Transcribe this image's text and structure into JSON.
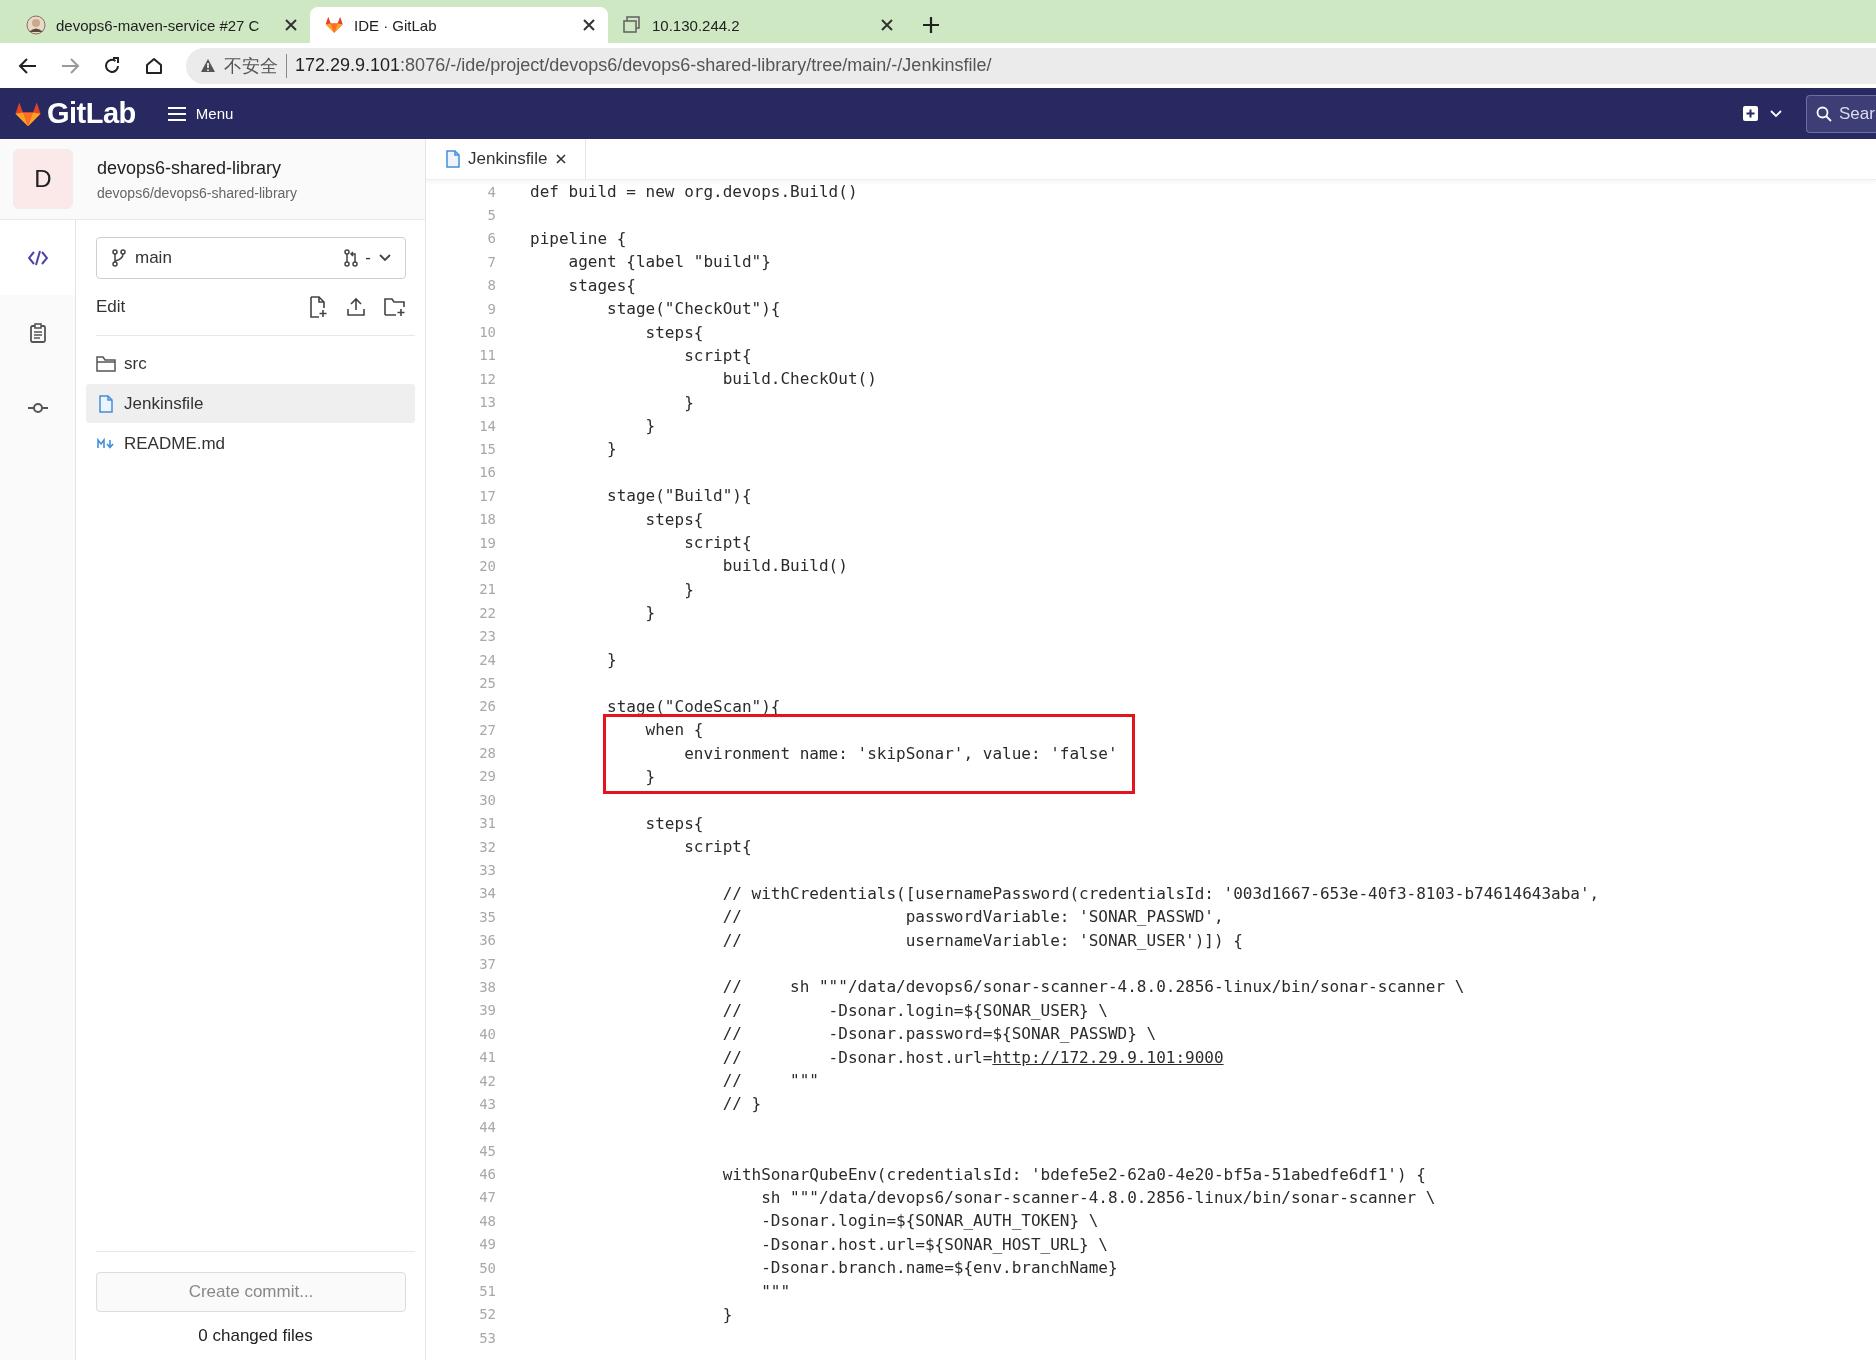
{
  "browser": {
    "tabs": [
      {
        "title": "devops6-maven-service #27 C",
        "kind": "avatar",
        "selected": false
      },
      {
        "title": "IDE · GitLab",
        "kind": "gitlab",
        "selected": true
      },
      {
        "title": "10.130.244.2",
        "kind": "page",
        "selected": false
      }
    ],
    "security_label": "不安全",
    "url_host": "172.29.9.101",
    "url_path": ":8076/-/ide/project/devops6/devops6-shared-library/tree/main/-/Jenkinsfile/"
  },
  "header": {
    "logo_text": "GitLab",
    "menu_label": "Menu",
    "search_placeholder": "Sear"
  },
  "project": {
    "avatar_letter": "D",
    "name": "devops6-shared-library",
    "path": "devops6/devops6-shared-library"
  },
  "rail": [
    {
      "kind": "code",
      "selected": true
    },
    {
      "kind": "review",
      "selected": false
    },
    {
      "kind": "commit",
      "selected": false
    }
  ],
  "branch": {
    "name": "main",
    "mr_label": "-"
  },
  "edit_label": "Edit",
  "files": [
    {
      "name": "src",
      "kind": "folder",
      "selected": false
    },
    {
      "name": "Jenkinsfile",
      "kind": "file",
      "selected": true
    },
    {
      "name": "README.md",
      "kind": "markdown",
      "selected": false
    }
  ],
  "commit_button": "Create commit...",
  "changed_files": "0 changed files",
  "editor": {
    "tabs": [
      {
        "title": "Jenkinsfile",
        "selected": true
      }
    ],
    "lines": [
      {
        "n": "4",
        "text": "def build = new org.devops.Build()",
        "boxed": false
      },
      {
        "n": "5",
        "boxed": false
      },
      {
        "n": "6",
        "text": "pipeline {",
        "boxed": false
      },
      {
        "n": "7",
        "text": "    agent {label \"build\"}",
        "boxed": false
      },
      {
        "n": "8",
        "text": "    stages{",
        "boxed": false
      },
      {
        "n": "9",
        "text": "        stage(\"CheckOut\"){",
        "boxed": false
      },
      {
        "n": "10",
        "text": "            steps{",
        "boxed": false
      },
      {
        "n": "11",
        "text": "                script{",
        "boxed": false
      },
      {
        "n": "12",
        "text": "                    build.CheckOut()",
        "boxed": false
      },
      {
        "n": "13",
        "text": "                }",
        "boxed": false
      },
      {
        "n": "14",
        "text": "            }",
        "boxed": false
      },
      {
        "n": "15",
        "text": "        }",
        "boxed": false
      },
      {
        "n": "16",
        "boxed": false
      },
      {
        "n": "17",
        "text": "        stage(\"Build\"){",
        "boxed": false
      },
      {
        "n": "18",
        "text": "            steps{",
        "boxed": false
      },
      {
        "n": "19",
        "text": "                script{",
        "boxed": false
      },
      {
        "n": "20",
        "text": "                    build.Build()",
        "boxed": false
      },
      {
        "n": "21",
        "text": "                }",
        "boxed": false
      },
      {
        "n": "22",
        "text": "            }",
        "boxed": false
      },
      {
        "n": "23",
        "boxed": false
      },
      {
        "n": "24",
        "text": "        }",
        "boxed": false
      },
      {
        "n": "25",
        "boxed": false
      },
      {
        "n": "26",
        "text": "        stage(\"CodeScan\"){",
        "boxed": false
      },
      {
        "n": "27",
        "text": "            when {",
        "boxed": true
      },
      {
        "n": "28",
        "text": "                environment name: 'skipSonar', value: 'false'",
        "boxed": true
      },
      {
        "n": "29",
        "text": "            }",
        "boxed": true
      },
      {
        "n": "30",
        "boxed": false
      },
      {
        "n": "31",
        "text": "            steps{",
        "boxed": false
      },
      {
        "n": "32",
        "text": "                script{",
        "boxed": false
      },
      {
        "n": "33",
        "boxed": false
      },
      {
        "n": "34",
        "text": "                    // withCredentials([usernamePassword(credentialsId: '003d1667-653e-40f3-8103-b74614643aba',",
        "boxed": false
      },
      {
        "n": "35",
        "text": "                    //                 passwordVariable: 'SONAR_PASSWD',",
        "boxed": false
      },
      {
        "n": "36",
        "text": "                    //                 usernameVariable: 'SONAR_USER')]) {",
        "boxed": false
      },
      {
        "n": "37",
        "boxed": false
      },
      {
        "n": "38",
        "text": "                    //     sh \"\"\"/data/devops6/sonar-scanner-4.8.0.2856-linux/bin/sonar-scanner \\",
        "boxed": false
      },
      {
        "n": "39",
        "text": "                    //         -Dsonar.login=${SONAR_USER} \\",
        "boxed": false
      },
      {
        "n": "40",
        "text": "                    //         -Dsonar.password=${SONAR_PASSWD} \\",
        "boxed": false
      },
      {
        "n": "41",
        "text": "                    //         -Dsonar.host.url=",
        "link": "http://172.29.9.101:9000",
        "boxed": false
      },
      {
        "n": "42",
        "text": "                    //     \"\"\"",
        "boxed": false
      },
      {
        "n": "43",
        "text": "                    // }",
        "boxed": false
      },
      {
        "n": "44",
        "boxed": false
      },
      {
        "n": "45",
        "boxed": false
      },
      {
        "n": "46",
        "text": "                    withSonarQubeEnv(credentialsId: 'bdefe5e2-62a0-4e20-bf5a-51abedfe6df1') {",
        "boxed": false
      },
      {
        "n": "47",
        "text": "                        sh \"\"\"/data/devops6/sonar-scanner-4.8.0.2856-linux/bin/sonar-scanner \\",
        "boxed": false
      },
      {
        "n": "48",
        "text": "                        -Dsonar.login=${SONAR_AUTH_TOKEN} \\",
        "boxed": false
      },
      {
        "n": "49",
        "text": "                        -Dsonar.host.url=${SONAR_HOST_URL} \\",
        "boxed": false
      },
      {
        "n": "50",
        "text": "                        -Dsonar.branch.name=${env.branchName}",
        "boxed": false
      },
      {
        "n": "51",
        "text": "                        \"\"\"",
        "boxed": false
      },
      {
        "n": "52",
        "text": "                    }",
        "boxed": false
      },
      {
        "n": "53",
        "boxed": false
      }
    ]
  }
}
